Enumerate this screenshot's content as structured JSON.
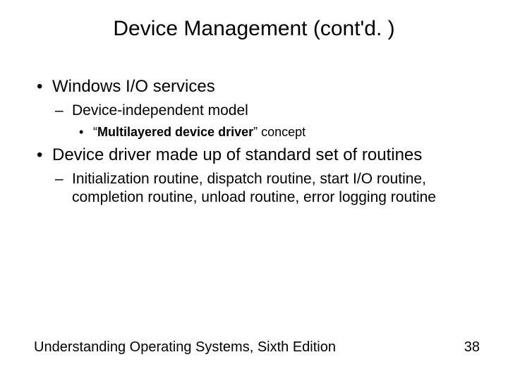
{
  "title": "Device Management (cont'd. )",
  "bullets": {
    "b1": "Windows I/O services",
    "b1_1": "Device-independent model",
    "b1_1_1_pre": "“",
    "b1_1_1_bold": "Multilayered device driver",
    "b1_1_1_post": "” concept",
    "b2": "Device driver made up of standard set of routines",
    "b2_1": "Initialization routine, dispatch routine, start I/O routine, completion routine, unload routine, error logging routine"
  },
  "footer": {
    "left": "Understanding Operating Systems, Sixth Edition",
    "right": "38"
  }
}
